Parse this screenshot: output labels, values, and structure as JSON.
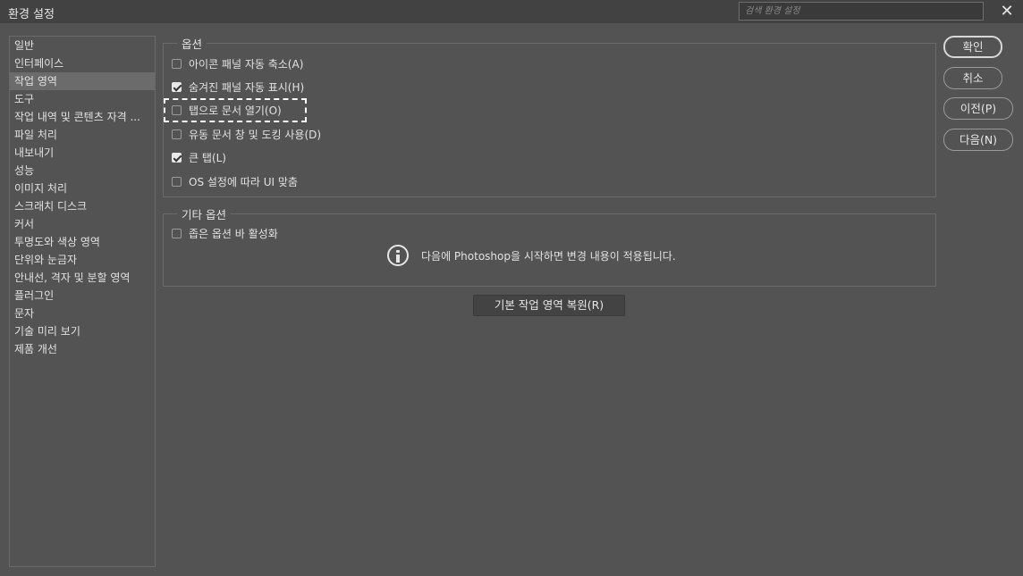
{
  "window": {
    "title": "환경 설정",
    "search_placeholder": "검색 환경 설정",
    "close_glyph": "✕"
  },
  "sidebar": {
    "items": [
      {
        "label": "일반",
        "selected": false
      },
      {
        "label": "인터페이스",
        "selected": false
      },
      {
        "label": "작업 영역",
        "selected": true
      },
      {
        "label": "도구",
        "selected": false
      },
      {
        "label": "작업 내역 및 콘텐츠 자격 ...",
        "selected": false
      },
      {
        "label": "파일 처리",
        "selected": false
      },
      {
        "label": "내보내기",
        "selected": false
      },
      {
        "label": "성능",
        "selected": false
      },
      {
        "label": "이미지 처리",
        "selected": false
      },
      {
        "label": "스크래치 디스크",
        "selected": false
      },
      {
        "label": "커서",
        "selected": false
      },
      {
        "label": "투명도와 색상 영역",
        "selected": false
      },
      {
        "label": "단위와 눈금자",
        "selected": false
      },
      {
        "label": "안내선, 격자 및 분할 영역",
        "selected": false
      },
      {
        "label": "플러그인",
        "selected": false
      },
      {
        "label": "문자",
        "selected": false
      },
      {
        "label": "기술 미리 보기",
        "selected": false
      },
      {
        "label": "제품 개선",
        "selected": false
      }
    ]
  },
  "options": {
    "title": "옵션",
    "items": [
      {
        "label": "아이콘 패널 자동 축소(A)",
        "checked": false
      },
      {
        "label": "숨겨진 패널 자동 표시(H)",
        "checked": true
      },
      {
        "label": "탭으로 문서 열기(O)",
        "checked": false
      },
      {
        "label": "유동 문서 창 및 도킹 사용(D)",
        "checked": false
      },
      {
        "label": "큰 탭(L)",
        "checked": true
      },
      {
        "label": "OS 설정에 따라 UI 맞춤",
        "checked": false
      }
    ]
  },
  "other_options": {
    "title": "기타 옵션",
    "items": [
      {
        "label": "좁은 옵션 바 활성화",
        "checked": false
      }
    ],
    "info_text": "다음에 Photoshop을 시작하면 변경 내용이 적용됩니다."
  },
  "restore_button": "기본 작업 영역 복원(R)",
  "buttons": {
    "ok": "확인",
    "cancel": "취소",
    "prev": "이전(P)",
    "next": "다음(N)"
  }
}
